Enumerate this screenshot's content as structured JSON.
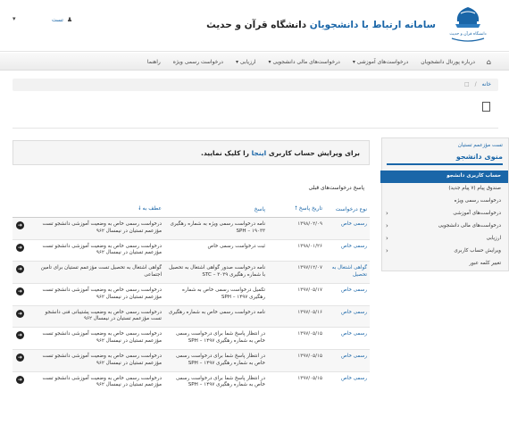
{
  "header": {
    "title_part1": "سامانه ارتباط با دانشجویان",
    "title_part2": "دانشگاه قرآن و حدیث",
    "user_label": "تست",
    "logo_text": "دانشگاه قرآن و حدیث"
  },
  "navbar": {
    "items": [
      "درباره پورتال دانشجویان",
      "درخواست‌های آموزشی",
      "درخواست‌های مالی دانشجویی",
      "ارزیابی",
      "درخواست رسمی ویژه",
      "راهنما"
    ]
  },
  "breadcrumb": {
    "home": "خانه"
  },
  "notice": {
    "prefix": "برای ویرایش حساب کاربری ",
    "link": "اینجا",
    "suffix": " را کلیک نمایید."
  },
  "table": {
    "title": "پاسخ درخواست‌های قبلی",
    "headers": {
      "type": "نوع درخواست",
      "date": "تاریخ پاسخ",
      "answer": "پاسخ",
      "ref": "عطف به"
    },
    "rows": [
      {
        "type": "رسمی خاص",
        "date": "۱۳۹۸/۰۲/۰۹",
        "answer": "نامه درخواست رسمی ویژه به شماره رهگیری SPH – ۱۹۰۳۳",
        "ref": "درخواست رسمی خاص به وضعیت آموزشی دانشجو تست مؤزعمم تستیان در نیمسال ۹۶۲"
      },
      {
        "type": "رسمی خاص",
        "date": "۱۳۹۸/۰۱/۲۶",
        "answer": "ثبت درخواست رسمی خاص",
        "ref": "درخواست رسمی خاص به وضعیت آموزشی دانشجو تست مؤزعمم تستیان در نیمسال ۹۶۲"
      },
      {
        "type": "گواهی اشتغال به تحصیل",
        "date": "۱۳۹۷/۱۲/۰۷",
        "answer": "نامه درخواست صدور گواهی اشتغال به تحصیل با شماره رهگیری STC – ۳۰۳۹",
        "ref": "گواهی اشتغال به تحصیل تست مؤزعمم تستیان برای تامین اجتماعی"
      },
      {
        "type": "رسمی خاص",
        "date": "۱۳۹۷/۰۵/۱۷",
        "answer": "تکمیل درخواست رسمی خاص به شماره رهگیری SPH – ۱۴۹۷",
        "ref": "درخواست رسمی خاص به وضعیت آموزشی دانشجو تست مؤزعمم تستیان در نیمسال ۹۶۲"
      },
      {
        "type": "رسمی خاص",
        "date": "۱۳۹۷/۰۵/۱۶",
        "answer": "نامه درخواست رسمی خاص به شماره رهگیری",
        "ref": "درخواست رسمی خاص به وضعیت پشتیبانی فنی دانشجو تست مؤزعمم تستیان در نیمسال ۹۶۲"
      },
      {
        "type": "رسمی خاص",
        "date": "۱۳۹۷/۰۵/۱۵",
        "answer": "در انتظار پاسخ شما برای درخواست رسمی خاص به شماره رهگیری SPH – ۱۴۹۷",
        "ref": "درخواست رسمی خاص به وضعیت آموزشی دانشجو تست مؤزعمم تستیان در نیمسال ۹۶۲"
      },
      {
        "type": "رسمی خاص",
        "date": "۱۳۹۷/۰۵/۱۵",
        "answer": "در انتظار پاسخ شما برای درخواست رسمی خاص به شماره رهگیری SPH – ۱۴۹۷",
        "ref": "درخواست رسمی خاص به وضعیت آموزشی دانشجو تست مؤزعمم تستیان در نیمسال ۹۶۲"
      },
      {
        "type": "رسمی خاص",
        "date": "۱۳۹۷/۰۵/۱۵",
        "answer": "در انتظار پاسخ شما برای درخواست رسمی خاص به شماره رهگیری SPH – ۱۴۹۷",
        "ref": "درخواست رسمی خاص به وضعیت آموزشی دانشجو تست مؤزعمم تستیان در نیمسال ۹۶۲"
      }
    ]
  },
  "sidebar": {
    "user": "تست مؤزعمم تستیان",
    "menu_title": "منوی دانشجو",
    "items": [
      "حساب کاربری دانشجو",
      "صندوق پیام (۷ پیام جدید)",
      "درخواست رسمی ویژه",
      "درخواست‌های آموزشی",
      "درخواست‌های مالی دانشجویی",
      "ارزیابی",
      "ویرایش حساب کاربری",
      "تغییر کلمه عبور"
    ]
  }
}
